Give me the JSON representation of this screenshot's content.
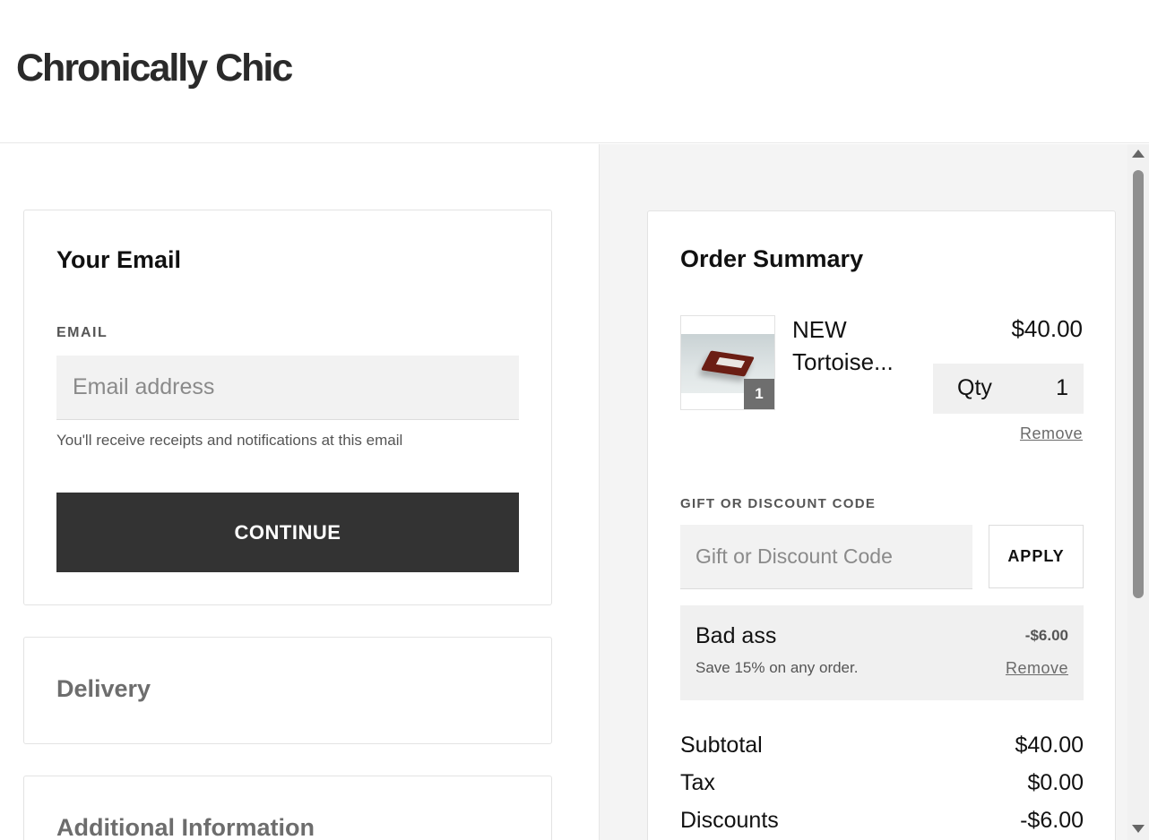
{
  "brand": {
    "name": "Chronically Chic"
  },
  "email_section": {
    "title": "Your Email",
    "label": "EMAIL",
    "placeholder": "Email address",
    "value": "",
    "help_text": "You'll receive receipts and notifications at this email",
    "continue_label": "CONTINUE"
  },
  "delivery_section": {
    "title": "Delivery"
  },
  "additional_section": {
    "title": "Additional Information"
  },
  "order_summary": {
    "title": "Order Summary",
    "item": {
      "name": "NEW Tortoise...",
      "price": "$40.00",
      "badge_count": "1",
      "qty_label": "Qty",
      "qty_value": "1",
      "remove_label": "Remove"
    },
    "gift_label": "GIFT OR DISCOUNT CODE",
    "gift_placeholder": "Gift or Discount Code",
    "apply_label": "APPLY",
    "discount": {
      "name": "Bad ass",
      "amount": "-$6.00",
      "description": "Save 15% on any order.",
      "remove_label": "Remove"
    },
    "totals": [
      {
        "label": "Subtotal",
        "value": "$40.00"
      },
      {
        "label": "Tax",
        "value": "$0.00"
      },
      {
        "label": "Discounts",
        "value": "-$6.00"
      }
    ]
  },
  "colors": {
    "button_dark": "#333333",
    "panel_gray": "#f4f4f4",
    "input_gray": "#f2f2f2"
  }
}
